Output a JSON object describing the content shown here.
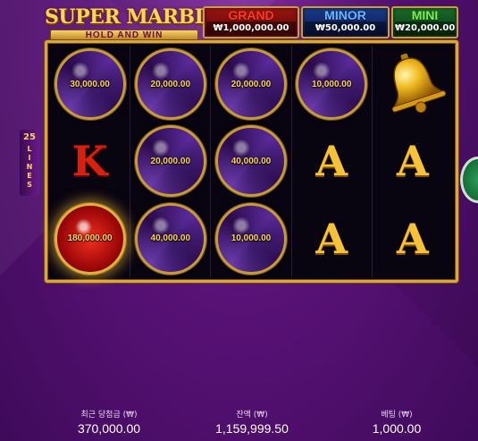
{
  "logo": {
    "title": "SUPER MARBLE",
    "subtitle": "HOLD AND WIN"
  },
  "jackpots": {
    "grand": {
      "label": "GRAND",
      "value": "₩1,000,000.00"
    },
    "minor": {
      "label": "MINOR",
      "value": "₩50,000.00"
    },
    "mini": {
      "label": "MINI",
      "value": "₩20,000.00"
    }
  },
  "lines": {
    "count": "25",
    "word": "LINES"
  },
  "reels": {
    "r0": [
      {
        "type": "marble-purple",
        "value": "30,000.00"
      },
      {
        "type": "marble-purple",
        "value": "20,000.00"
      },
      {
        "type": "marble-purple",
        "value": "20,000.00"
      },
      {
        "type": "marble-purple",
        "value": "10,000.00"
      },
      {
        "type": "bell",
        "value": ""
      }
    ],
    "r1": [
      {
        "type": "letter-k",
        "value": "K"
      },
      {
        "type": "marble-purple",
        "value": "20,000.00"
      },
      {
        "type": "marble-purple",
        "value": "40,000.00"
      },
      {
        "type": "letter-a",
        "value": "A"
      },
      {
        "type": "letter-a",
        "value": "A"
      }
    ],
    "r2": [
      {
        "type": "marble-red",
        "value": "180,000.00"
      },
      {
        "type": "marble-purple",
        "value": "40,000.00"
      },
      {
        "type": "marble-purple",
        "value": "10,000.00"
      },
      {
        "type": "letter-a",
        "value": "A"
      },
      {
        "type": "letter-a",
        "value": "A"
      }
    ]
  },
  "bottom": {
    "win": {
      "label": "최근 당첨금 (₩)",
      "value": "370,000.00"
    },
    "balance": {
      "label": "잔액 (₩)",
      "value": "1,159,999.50"
    },
    "bet": {
      "label": "베팅 (₩)",
      "value": "1,000.00"
    }
  },
  "colors": {
    "frame_gold": "#d9a83a",
    "grand": "#ff3a20",
    "minor": "#6ab8ff",
    "mini": "#7ef04a",
    "marble_value": "#ffd45a"
  }
}
